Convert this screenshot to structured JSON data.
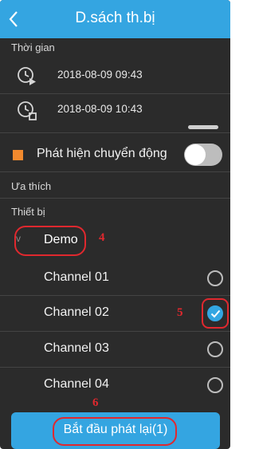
{
  "header": {
    "title": "D.sách th.bị",
    "back_glyph": "<"
  },
  "time_section": {
    "label": "Thời gian",
    "start": "2018-08-09 09:43",
    "end": "2018-08-09 10:43"
  },
  "motion": {
    "label": "Phát hiện chuyển động",
    "enabled": false
  },
  "favorites": {
    "label": "Ưa thích"
  },
  "devices": {
    "label": "Thiết bị",
    "group": {
      "name": "Demo",
      "chevron": "v"
    },
    "channels": [
      {
        "name": "Channel 01",
        "checked": false
      },
      {
        "name": "Channel 02",
        "checked": true
      },
      {
        "name": "Channel 03",
        "checked": false
      },
      {
        "name": "Channel 04",
        "checked": false
      }
    ]
  },
  "annotations": {
    "demo": "4",
    "channel": "5",
    "button": "6"
  },
  "actions": {
    "start_playback": "Bắt đầu phát lại(1)"
  },
  "colors": {
    "accent": "#34a5e1",
    "background": "#2b2b2b",
    "annotation": "#e0282e",
    "motion_icon": "#f28a2e"
  }
}
